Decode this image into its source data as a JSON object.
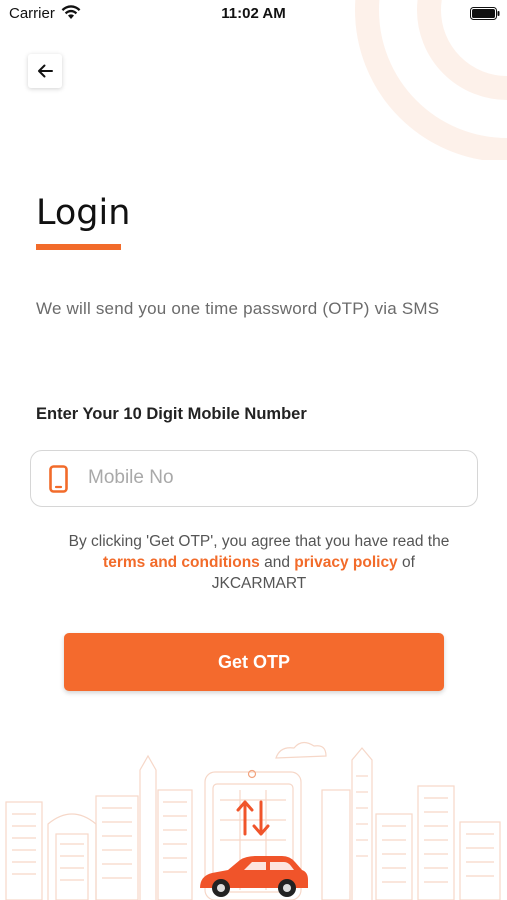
{
  "status_bar": {
    "carrier": "Carrier",
    "time": "11:02 AM"
  },
  "header": {
    "back_icon": "arrow-left-icon"
  },
  "login": {
    "title": "Login",
    "info": "We will send you one time password (OTP) via SMS",
    "mobile_label": "Enter Your 10 Digit Mobile Number",
    "mobile_placeholder": "Mobile No",
    "mobile_value": ""
  },
  "terms": {
    "prefix": "By clicking 'Get OTP', you agree that you have read the",
    "terms_link": "terms and conditions",
    "and": "and",
    "privacy_link": "privacy policy",
    "suffix_of": "of",
    "brand": "JKCARMART"
  },
  "actions": {
    "get_otp": "Get OTP"
  },
  "colors": {
    "accent": "#f26b2a",
    "button": "#f46a2d",
    "illustration_line": "#f6d7c8"
  }
}
